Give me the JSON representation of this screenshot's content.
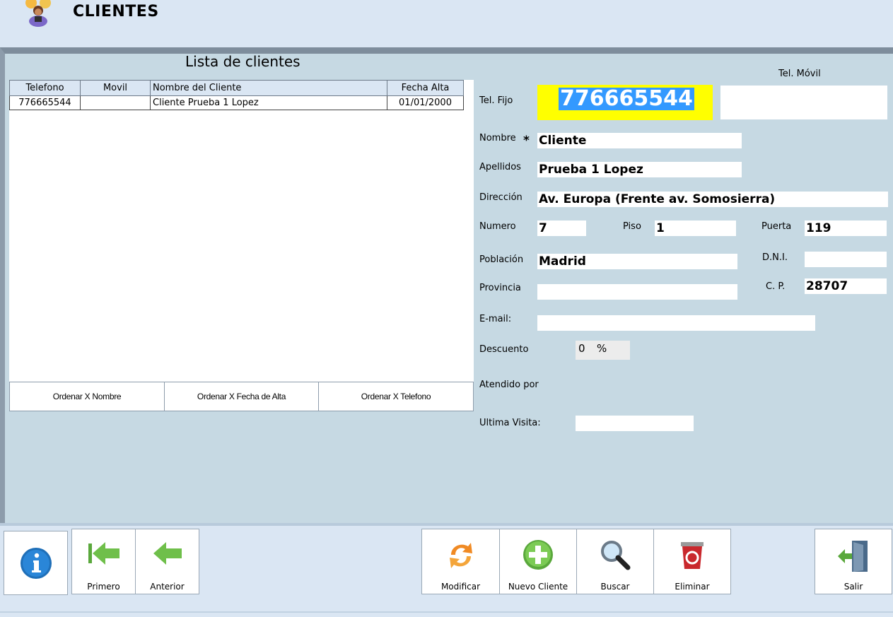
{
  "header": {
    "title": "CLIENTES"
  },
  "list": {
    "title": "Lista de clientes",
    "columns": [
      "Telefono",
      "Movil",
      "Nombre del Cliente",
      "Fecha Alta"
    ],
    "rows": [
      [
        "776665544",
        "",
        "Cliente Prueba 1 Lopez",
        "01/01/2000"
      ]
    ],
    "sort_buttons": [
      "Ordenar X Nombre",
      "Ordenar X Fecha de Alta",
      "Ordenar X Telefono"
    ]
  },
  "form": {
    "tel_movil_label": "Tel. Móvil",
    "tel_fijo_label": "Tel. Fijo",
    "tel_fijo_value": "776665544",
    "tel_movil_value": "",
    "nombre_label": "Nombre",
    "required_mark": "*",
    "nombre_value": "Cliente",
    "apellidos_label": "Apellidos",
    "apellidos_value": "Prueba 1 Lopez",
    "direccion_label": "Dirección",
    "direccion_value": "Av. Europa (Frente av. Somosierra)",
    "numero_label": "Numero",
    "numero_value": "7",
    "piso_label": "Piso",
    "piso_value": "1",
    "puerta_label": "Puerta",
    "puerta_value": "119",
    "poblacion_label": "Población",
    "poblacion_value": "Madrid",
    "dni_label": "D.N.I.",
    "dni_value": "",
    "provincia_label": "Provincia",
    "provincia_value": "",
    "cp_label": "C. P.",
    "cp_value": "28707",
    "email_label": "E-mail:",
    "email_value": "",
    "descuento_label": "Descuento",
    "descuento_value": "0",
    "descuento_unit": "%",
    "atendido_label": "Atendido por",
    "ultima_label": "Ultima Visita:",
    "ultima_value": ""
  },
  "toolbar": {
    "info_icon": "info-icon",
    "primero": "Primero",
    "anterior": "Anterior",
    "modificar": "Modificar",
    "nuevo": "Nuevo Cliente",
    "buscar": "Buscar",
    "eliminar": "Eliminar",
    "salir": "Salir"
  },
  "colors": {
    "highlight_field": "#ffff00",
    "selection": "#3399ff",
    "panel": "#c6d9e3",
    "background": "#dae6f3"
  }
}
